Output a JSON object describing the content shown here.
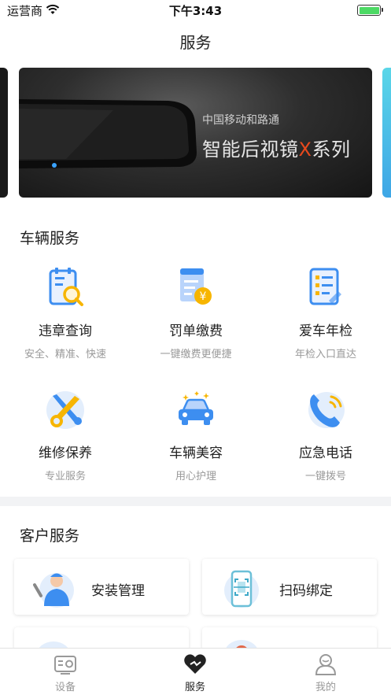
{
  "status_bar": {
    "carrier": "运营商",
    "time": "下午3:43"
  },
  "nav": {
    "title": "服务"
  },
  "banner": {
    "subtitle": "中国移动和路通",
    "title_prefix": "智能后视镜",
    "title_highlight": "X",
    "title_suffix": "系列",
    "highlight_color": "#e8491d"
  },
  "vehicle_services": {
    "title": "车辆服务",
    "items": [
      {
        "label": "违章查询",
        "desc": "安全、精准、快速",
        "icon": "violation-search-icon"
      },
      {
        "label": "罚单缴费",
        "desc": "一键缴费更便捷",
        "icon": "fine-payment-icon"
      },
      {
        "label": "爱车年检",
        "desc": "年检入口直达",
        "icon": "annual-inspection-icon"
      },
      {
        "label": "维修保养",
        "desc": "专业服务",
        "icon": "repair-tools-icon"
      },
      {
        "label": "车辆美容",
        "desc": "用心护理",
        "icon": "car-beauty-icon"
      },
      {
        "label": "应急电话",
        "desc": "一键拨号",
        "icon": "emergency-phone-icon"
      }
    ]
  },
  "customer_services": {
    "title": "客户服务",
    "items": [
      {
        "label": "安装管理",
        "icon": "installer-icon"
      },
      {
        "label": "扫码绑定",
        "icon": "scan-bind-icon"
      }
    ]
  },
  "tabbar": {
    "tabs": [
      {
        "label": "设备",
        "icon": "device-icon",
        "active": false
      },
      {
        "label": "服务",
        "icon": "heart-icon",
        "active": true
      },
      {
        "label": "我的",
        "icon": "profile-icon",
        "active": false
      }
    ]
  },
  "colors": {
    "accent_blue": "#3d8ef0",
    "accent_yellow": "#f7b500",
    "divider": "#f2f3f5"
  }
}
